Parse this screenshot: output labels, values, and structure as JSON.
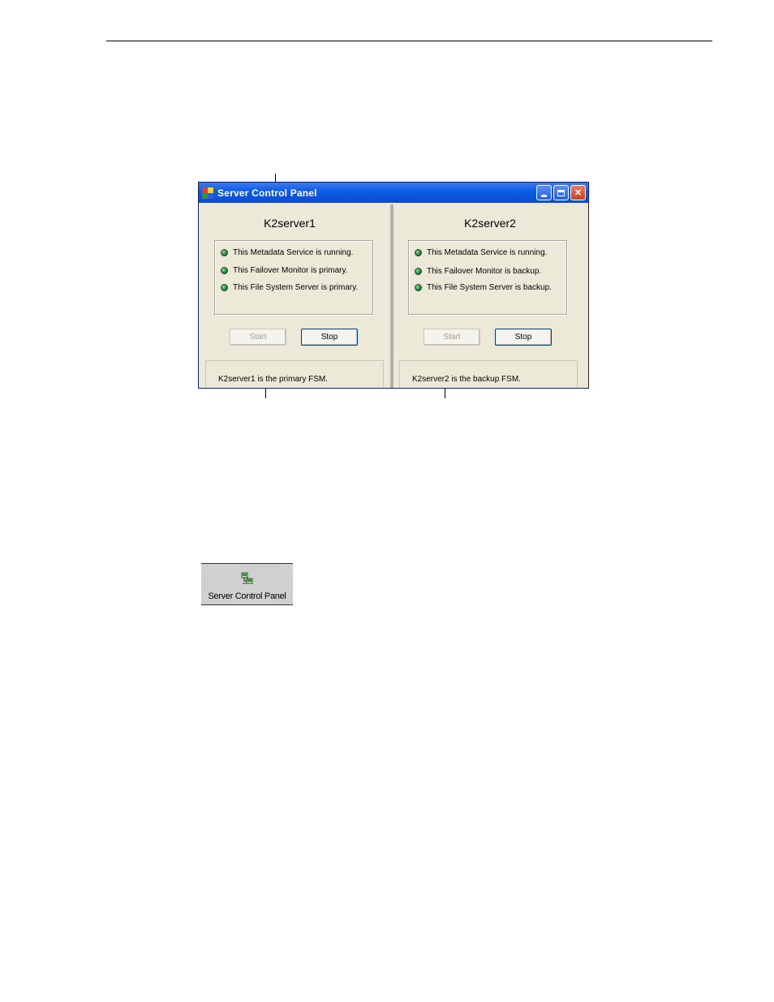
{
  "window": {
    "title": "Server Control Panel",
    "minimize": "minimize",
    "maximize": "maximize",
    "close": "✕"
  },
  "servers": [
    {
      "name": "K2server1",
      "statuses": [
        "This Metadata Service is running.",
        "This Failover Monitor is primary.",
        "This File System Server is primary."
      ],
      "start_label": "Start",
      "stop_label": "Stop",
      "message": "K2server1 is the primary FSM."
    },
    {
      "name": "K2server2",
      "statuses": [
        "This Metadata Service is running.",
        "This Failover Monitor is backup.",
        "This File System Server is backup."
      ],
      "start_label": "Start",
      "stop_label": "Stop",
      "message": "K2server2 is the backup FSM."
    }
  ],
  "toolbar_button": {
    "label": "Server Control Panel"
  },
  "colors": {
    "titlebar": "#0a4ad0",
    "window_bg": "#ece9d8",
    "status_led": "#1f8a3a"
  }
}
